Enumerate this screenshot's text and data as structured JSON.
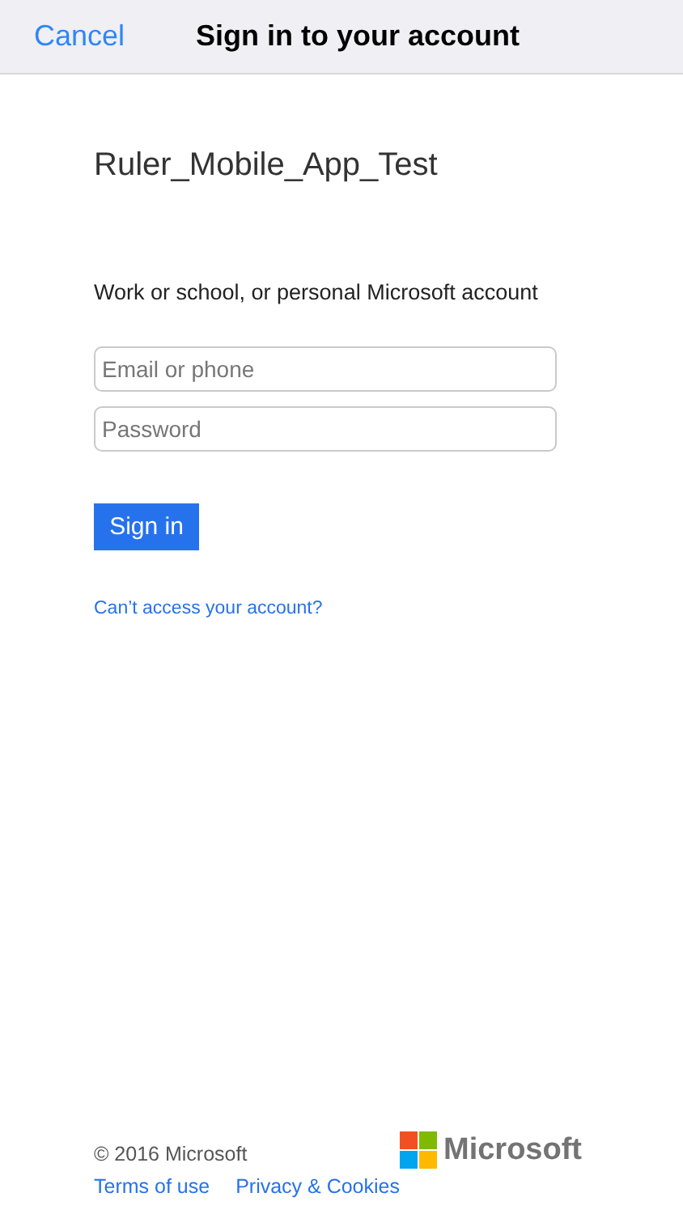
{
  "nav_bar": {
    "cancel": "Cancel",
    "title": "Sign in to your account"
  },
  "app_name": "Ruler_Mobile_App_Test",
  "account_hint": "Work or school, or personal Microsoft account",
  "fields": [
    {
      "placeholder": "Email or phone"
    },
    {
      "placeholder": "Password"
    }
  ],
  "sign_in_button": "Sign in",
  "help_link": "Can’t access your account?",
  "footer": {
    "copyright": "© 2016 Microsoft",
    "links": [
      "Terms of use",
      "Privacy & Cookies"
    ],
    "logo_text": "Microsoft"
  }
}
